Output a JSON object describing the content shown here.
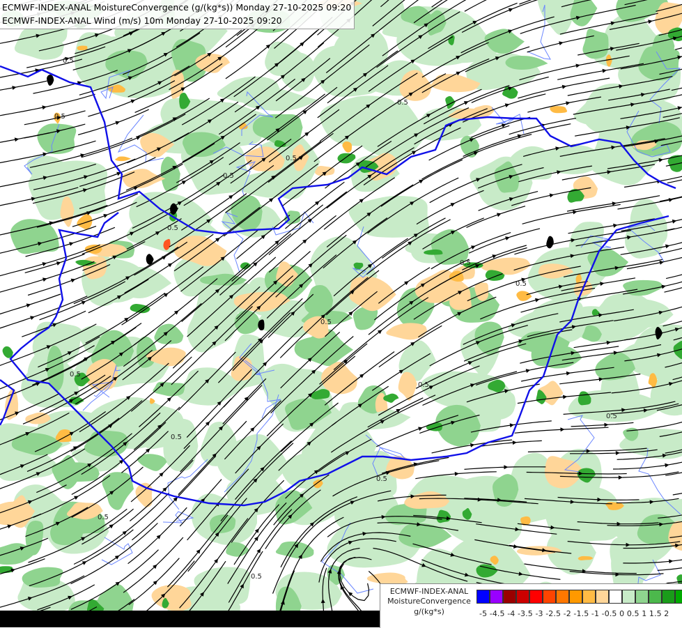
{
  "header": {
    "line1": "ECMWF-INDEX-ANAL MoistureConvergence (g/(kg*s)) Monday 27-10-2025 09:20",
    "line2": "ECMWF-INDEX-ANAL Wind (m/s) 10m Monday 27-10-2025 09:20"
  },
  "legend": {
    "title1": "ECMWF-INDEX-ANAL",
    "title2": "MoistureConvergence",
    "unit": "g/(kg*s)",
    "tick_text": "-5 -4.5 -4 -3.5 -3 -2.5 -2 -1.5 -1 -0.5 0  0.5  1  1.5  2",
    "colors": [
      "#0000ff",
      "#9900ff",
      "#990000",
      "#cc0000",
      "#ff0000",
      "#ff4400",
      "#ff7700",
      "#ff9900",
      "#ffbb44",
      "#ffd699",
      "#ffffff",
      "#c8ebc8",
      "#8fd48f",
      "#4cb84c",
      "#1a9c1a",
      "#00aa00"
    ]
  },
  "contour_label": "0.5",
  "colors": {
    "border": "#0000ff",
    "streamline": "#000000",
    "river": "#4d6bff",
    "green_light": "#c8ebc8",
    "green_mid": "#8fd48f",
    "green_dark": "#33aa33",
    "orange_light": "#ffd699",
    "orange_mid": "#ffbb44",
    "orange_dark": "#ff7700"
  }
}
